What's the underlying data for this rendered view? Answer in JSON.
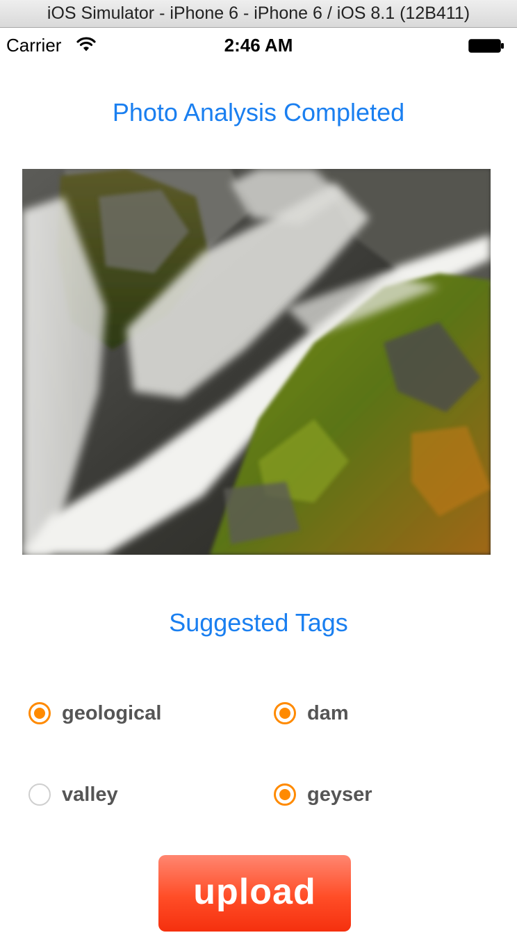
{
  "simulator": {
    "window_title": "iOS Simulator - iPhone 6 - iPhone 6 / iOS 8.1 (12B411)"
  },
  "status_bar": {
    "carrier": "Carrier",
    "time": "2:46 AM",
    "icons": [
      "wifi-icon",
      "battery-icon"
    ]
  },
  "header": {
    "title": "Photo Analysis Completed",
    "color": "#1a7ff0"
  },
  "photo": {
    "subject": "waterfall flowing over mossy rocks"
  },
  "tags": {
    "title": "Suggested Tags",
    "accent": "#ff8a00",
    "items": [
      {
        "label": "geological",
        "selected": true
      },
      {
        "label": "dam",
        "selected": true
      },
      {
        "label": "valley",
        "selected": false
      },
      {
        "label": "geyser",
        "selected": true
      }
    ]
  },
  "actions": {
    "upload_label": "upload",
    "upload_color": "#ff4d27"
  }
}
